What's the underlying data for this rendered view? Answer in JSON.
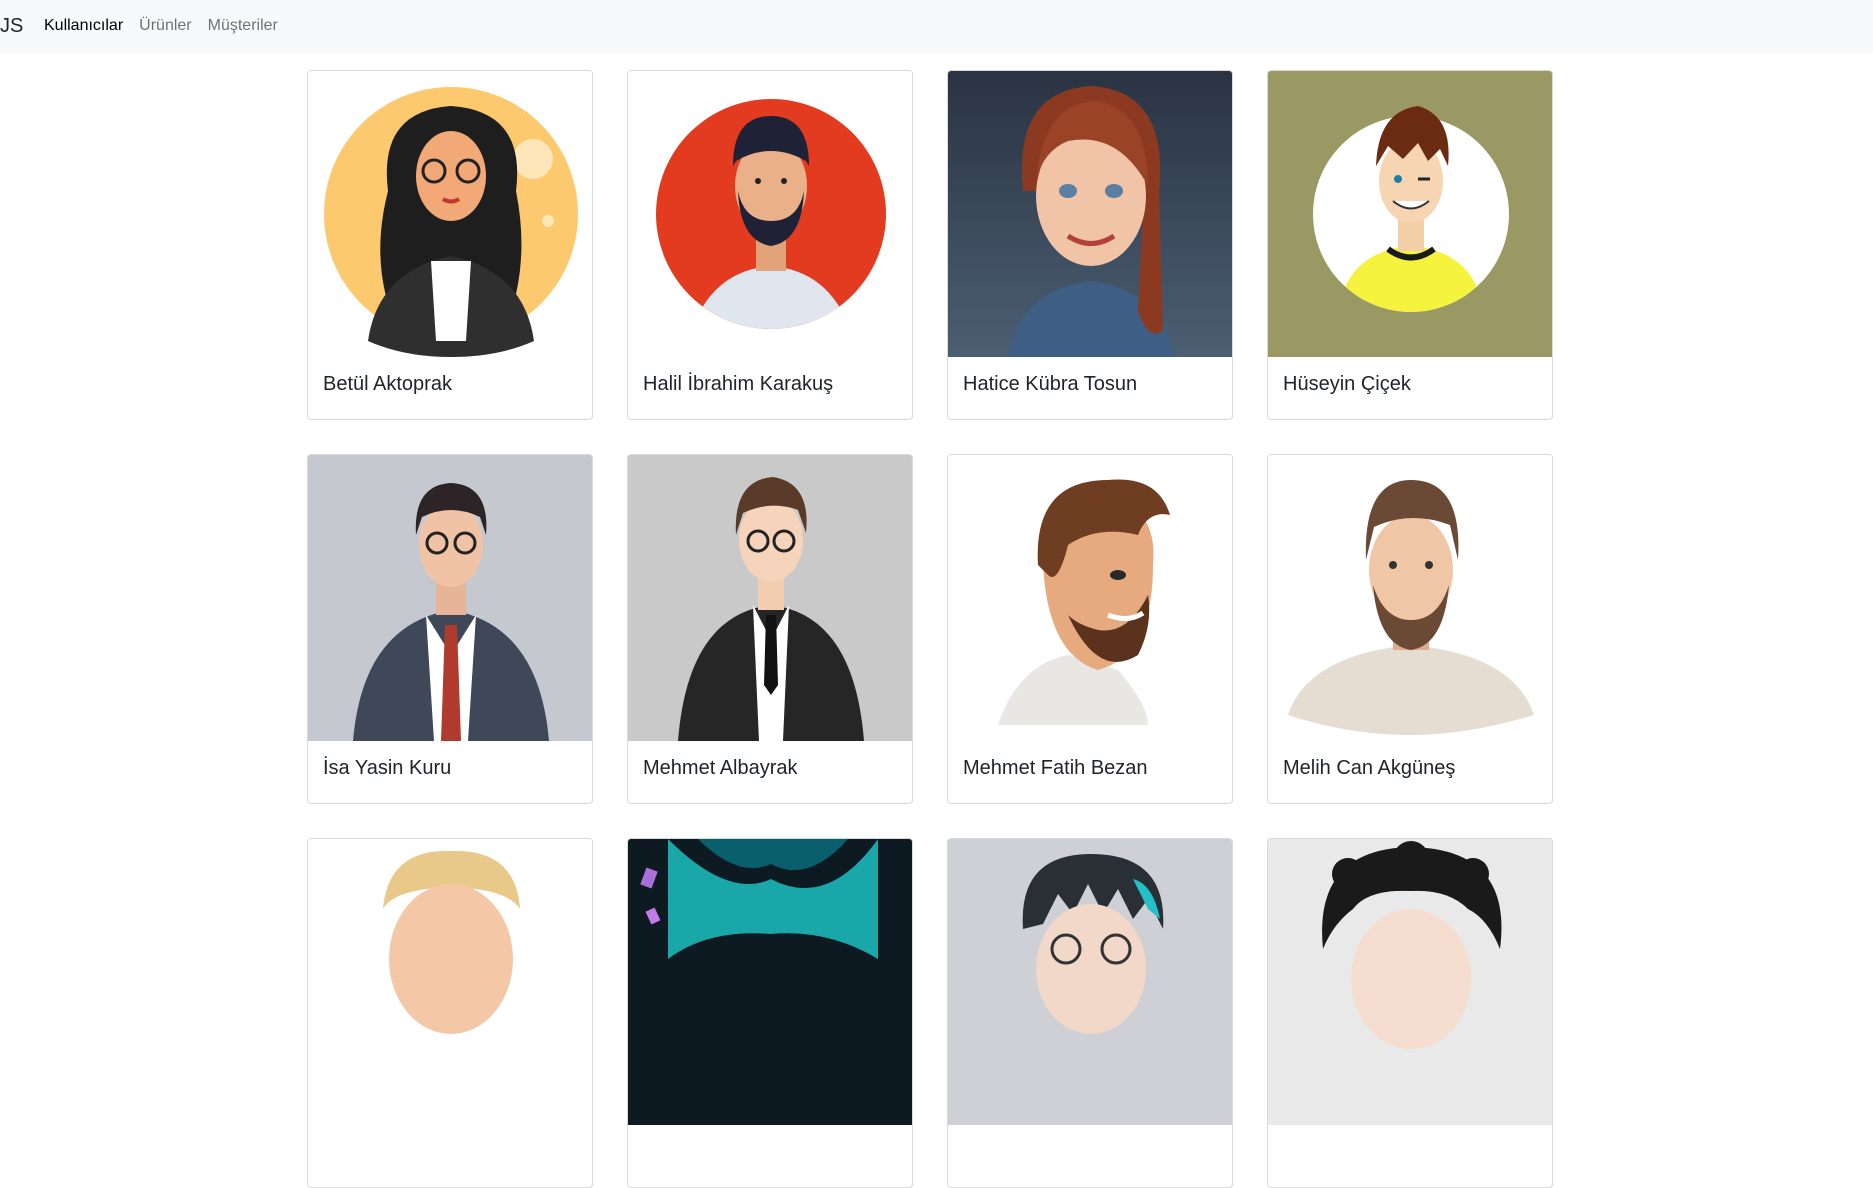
{
  "navbar": {
    "brand": "JS",
    "links": [
      {
        "label": "Kullanıcılar",
        "active": true
      },
      {
        "label": "Ürünler",
        "active": false
      },
      {
        "label": "Müşteriler",
        "active": false
      }
    ]
  },
  "users": [
    {
      "name": "Betül Aktoprak",
      "avatar": "woman-glasses-curly-hair-avatar"
    },
    {
      "name": "Halil İbrahim Karakuş",
      "avatar": "bearded-man-red-circle-avatar"
    },
    {
      "name": "Hatice Kübra Tosun",
      "avatar": "woman-red-hair-avatar"
    },
    {
      "name": "Hüseyin Çiçek",
      "avatar": "winking-man-yellow-shirt-avatar"
    },
    {
      "name": "İsa Yasin Kuru",
      "avatar": "man-suit-glasses-avatar"
    },
    {
      "name": "Mehmet Albayrak",
      "avatar": "young-man-black-suit-avatar"
    },
    {
      "name": "Mehmet Fatih Bezan",
      "avatar": "bearded-man-profile-avatar"
    },
    {
      "name": "Melih Can Akgüneş",
      "avatar": "bearded-man-tshirt-avatar"
    },
    {
      "name": "",
      "avatar": "blond-man-avatar"
    },
    {
      "name": "",
      "avatar": "neon-hair-avatar"
    },
    {
      "name": "",
      "avatar": "anime-glasses-avatar"
    },
    {
      "name": "",
      "avatar": "curly-hair-sketch-avatar"
    }
  ]
}
